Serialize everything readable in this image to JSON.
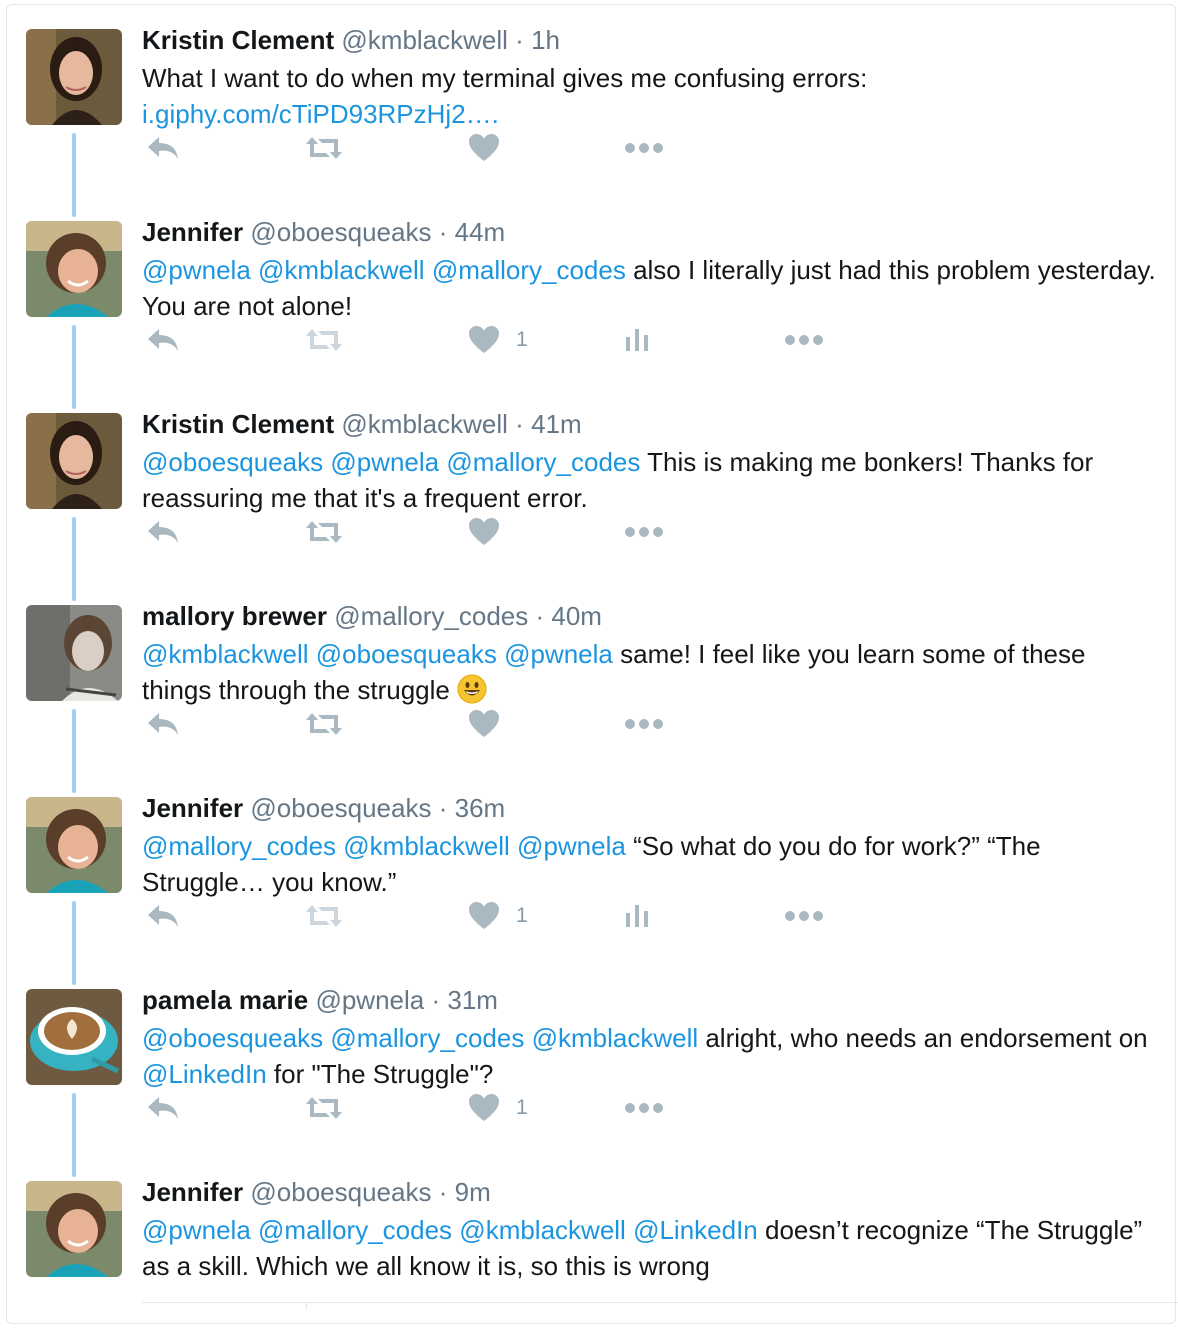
{
  "tweets": [
    {
      "name": "Kristin Clement",
      "handle": "@kmblackwell",
      "time": "1h",
      "segments": [
        {
          "text": "What I want to do when my terminal gives me confusing errors: ",
          "type": "text"
        },
        {
          "text": "i.giphy.com/cTiPD93RPzHj2….",
          "type": "link"
        }
      ],
      "avatar": "kristin",
      "retweet_active": true,
      "like_count": "",
      "show_analytics": false
    },
    {
      "name": "Jennifer",
      "handle": "@oboesqueaks",
      "time": "44m",
      "segments": [
        {
          "text": "@pwnela",
          "type": "link"
        },
        {
          "text": " ",
          "type": "text"
        },
        {
          "text": "@kmblackwell",
          "type": "link"
        },
        {
          "text": " ",
          "type": "text"
        },
        {
          "text": "@mallory_codes",
          "type": "link"
        },
        {
          "text": " also I literally just had this problem yesterday. You are not alone!",
          "type": "text"
        }
      ],
      "avatar": "jennifer",
      "retweet_active": false,
      "like_count": "1",
      "show_analytics": true
    },
    {
      "name": "Kristin Clement",
      "handle": "@kmblackwell",
      "time": "41m",
      "segments": [
        {
          "text": "@oboesqueaks",
          "type": "link"
        },
        {
          "text": " ",
          "type": "text"
        },
        {
          "text": "@pwnela",
          "type": "link"
        },
        {
          "text": " ",
          "type": "text"
        },
        {
          "text": "@mallory_codes",
          "type": "link"
        },
        {
          "text": " This is making me bonkers! Thanks for reassuring me that it's a frequent error.",
          "type": "text"
        }
      ],
      "avatar": "kristin",
      "retweet_active": true,
      "like_count": "",
      "show_analytics": false
    },
    {
      "name": "mallory brewer",
      "handle": "@mallory_codes",
      "time": "40m",
      "segments": [
        {
          "text": "@kmblackwell",
          "type": "link"
        },
        {
          "text": " ",
          "type": "text"
        },
        {
          "text": "@oboesqueaks",
          "type": "link"
        },
        {
          "text": " ",
          "type": "text"
        },
        {
          "text": "@pwnela",
          "type": "link"
        },
        {
          "text": " same! I feel like you learn some of these things through the struggle ",
          "type": "text"
        },
        {
          "text": "",
          "type": "emoji"
        }
      ],
      "avatar": "mallory",
      "retweet_active": true,
      "like_count": "",
      "show_analytics": false
    },
    {
      "name": "Jennifer",
      "handle": "@oboesqueaks",
      "time": "36m",
      "segments": [
        {
          "text": "@mallory_codes",
          "type": "link"
        },
        {
          "text": " ",
          "type": "text"
        },
        {
          "text": "@kmblackwell",
          "type": "link"
        },
        {
          "text": " ",
          "type": "text"
        },
        {
          "text": "@pwnela",
          "type": "link"
        },
        {
          "text": " “So what do you do for work?” “The Struggle… you know.”",
          "type": "text"
        }
      ],
      "avatar": "jennifer",
      "retweet_active": false,
      "like_count": "1",
      "show_analytics": true
    },
    {
      "name": "pamela marie",
      "handle": "@pwnela",
      "time": "31m",
      "segments": [
        {
          "text": "@oboesqueaks",
          "type": "link"
        },
        {
          "text": " ",
          "type": "text"
        },
        {
          "text": "@mallory_codes",
          "type": "link"
        },
        {
          "text": " ",
          "type": "text"
        },
        {
          "text": "@kmblackwell",
          "type": "link"
        },
        {
          "text": " alright, who needs an endorsement on ",
          "type": "text"
        },
        {
          "text": "@LinkedIn",
          "type": "link"
        },
        {
          "text": " for \"The Struggle\"?",
          "type": "text"
        }
      ],
      "avatar": "pamela",
      "retweet_active": true,
      "like_count": "1",
      "show_analytics": false
    },
    {
      "name": "Jennifer",
      "handle": "@oboesqueaks",
      "time": "9m",
      "segments": [
        {
          "text": "@pwnela",
          "type": "link"
        },
        {
          "text": " ",
          "type": "text"
        },
        {
          "text": "@mallory_codes",
          "type": "link"
        },
        {
          "text": " ",
          "type": "text"
        },
        {
          "text": "@kmblackwell",
          "type": "link"
        },
        {
          "text": " ",
          "type": "text"
        },
        {
          "text": "@LinkedIn",
          "type": "link"
        },
        {
          "text": " doesn’t recognize “The Struggle” as a skill. Which we all know it is, so this is wrong",
          "type": "text"
        }
      ],
      "avatar": "jennifer",
      "retweet_active": false,
      "like_count": "",
      "show_analytics": false
    }
  ],
  "separator": "·",
  "colors": {
    "name": "#14171a",
    "muted": "#657786",
    "link": "#1b95e0",
    "thread_line": "#9dd1f3",
    "icon": "#aab8c2",
    "icon_faded": "#cdd6dd"
  },
  "icons": {
    "reply": "reply-icon",
    "retweet": "retweet-icon",
    "like": "heart-icon",
    "analytics": "analytics-icon",
    "more": "more-icon",
    "emoji": "smiley-emoji"
  }
}
